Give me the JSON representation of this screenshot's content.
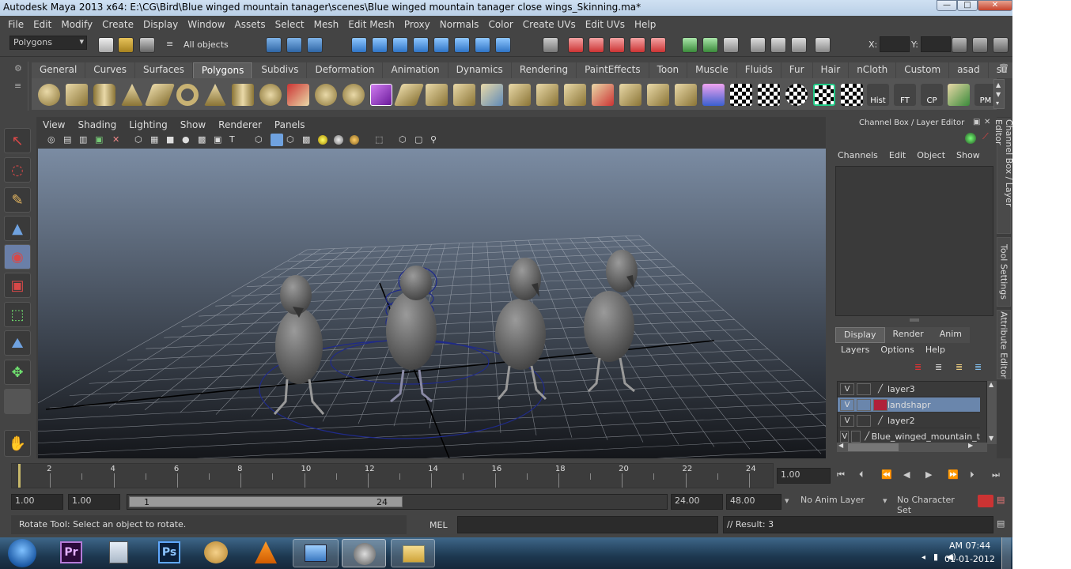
{
  "window": {
    "title": "Autodesk Maya 2013 x64: E:\\CG\\Bird\\Blue winged mountain tanager\\scenes\\Blue winged mountain tanager close wings_Skinning.ma*",
    "min": "—",
    "max": "□",
    "close": "✕"
  },
  "menu": [
    "File",
    "Edit",
    "Modify",
    "Create",
    "Display",
    "Window",
    "Assets",
    "Select",
    "Mesh",
    "Edit Mesh",
    "Proxy",
    "Normals",
    "Color",
    "Create UVs",
    "Edit UVs",
    "Help"
  ],
  "status": {
    "mode": "Polygons",
    "selection": "All objects",
    "x_label": "X:",
    "y_label": "Y:"
  },
  "shelf_tabs": [
    "General",
    "Curves",
    "Surfaces",
    "Polygons",
    "Subdivs",
    "Deformation",
    "Animation",
    "Dynamics",
    "Rendering",
    "PaintEffects",
    "Toon",
    "Muscle",
    "Fluids",
    "Fur",
    "Hair",
    "nCloth",
    "Custom",
    "asad",
    "su"
  ],
  "shelf_active": "Polygons",
  "shelf_labels": {
    "hist": "Hist",
    "ft": "FT",
    "cp": "CP",
    "pm": "PM"
  },
  "viewport_menu": [
    "View",
    "Shading",
    "Lighting",
    "Show",
    "Renderer",
    "Panels"
  ],
  "channel_box": {
    "title": "Channel Box / Layer Editor",
    "menu": [
      "Channels",
      "Edit",
      "Object",
      "Show"
    ],
    "layer_tabs": [
      "Display",
      "Render",
      "Anim"
    ],
    "layer_menu": [
      "Layers",
      "Options",
      "Help"
    ],
    "layers": [
      {
        "v": "V",
        "name": "layer3",
        "color": "",
        "selected": false
      },
      {
        "v": "V",
        "name": "landshapr",
        "color": "#b0203a",
        "selected": true
      },
      {
        "v": "V",
        "name": "layer2",
        "color": "",
        "selected": false
      },
      {
        "v": "V",
        "name": "Blue_winged_mountain_t",
        "color": "",
        "selected": false
      }
    ]
  },
  "side_tabs": [
    "Channel Box / Layer Editor",
    "Tool Settings",
    "Attribute Editor"
  ],
  "timeline": {
    "ticks": [
      "2",
      "4",
      "6",
      "8",
      "10",
      "12",
      "14",
      "16",
      "18",
      "20",
      "22",
      "24"
    ],
    "current": "1.00"
  },
  "range": {
    "start": "1.00",
    "inner_start": "1.00",
    "slider_start": "1",
    "slider_end": "24",
    "end": "24.00",
    "anim_end": "48.00",
    "anim_layer": "No Anim Layer",
    "char_set": "No Character Set"
  },
  "cmd": {
    "help": "Rotate Tool: Select an object to rotate.",
    "lang": "MEL",
    "result": "// Result: 3"
  },
  "taskbar": {
    "time": "AM 07:44",
    "date": "01-01-2012"
  }
}
